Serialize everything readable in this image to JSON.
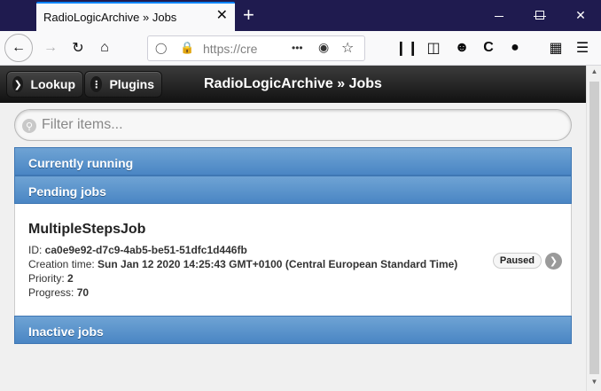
{
  "browser": {
    "tab_title": "RadioLogicArchive » Jobs",
    "tab_close": "✕",
    "new_tab": "+",
    "url": "https://cre",
    "url_more": "•••"
  },
  "app": {
    "lookup_label": "Lookup",
    "plugins_label": "Plugins",
    "title": "RadioLogicArchive » Jobs",
    "filter_placeholder": "Filter items..."
  },
  "sections": {
    "running": "Currently running",
    "pending": "Pending jobs",
    "inactive": "Inactive jobs"
  },
  "job": {
    "name": "MultipleStepsJob",
    "id_label": "ID: ",
    "id": "ca0e9e92-d7c9-4ab5-be51-51dfc1d446fb",
    "creation_label": "Creation time: ",
    "creation": "Sun Jan 12 2020 14:25:43 GMT+0100 (Central European Standard Time)",
    "priority_label": "Priority: ",
    "priority": "2",
    "progress_label": "Progress: ",
    "progress": "70",
    "status": "Paused"
  }
}
